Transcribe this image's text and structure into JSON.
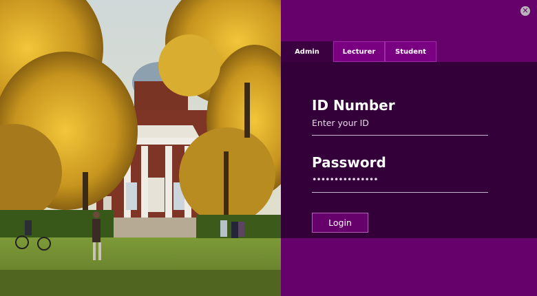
{
  "window": {
    "close_symbol": "✕"
  },
  "tabs": [
    {
      "label": "Admin"
    },
    {
      "label": "Lecturer"
    },
    {
      "label": "Student"
    }
  ],
  "form": {
    "id_label": "ID Number",
    "id_placeholder": "Enter your ID",
    "password_label": "Password",
    "password_value": "•••••••••••••••",
    "login_label": "Login"
  }
}
